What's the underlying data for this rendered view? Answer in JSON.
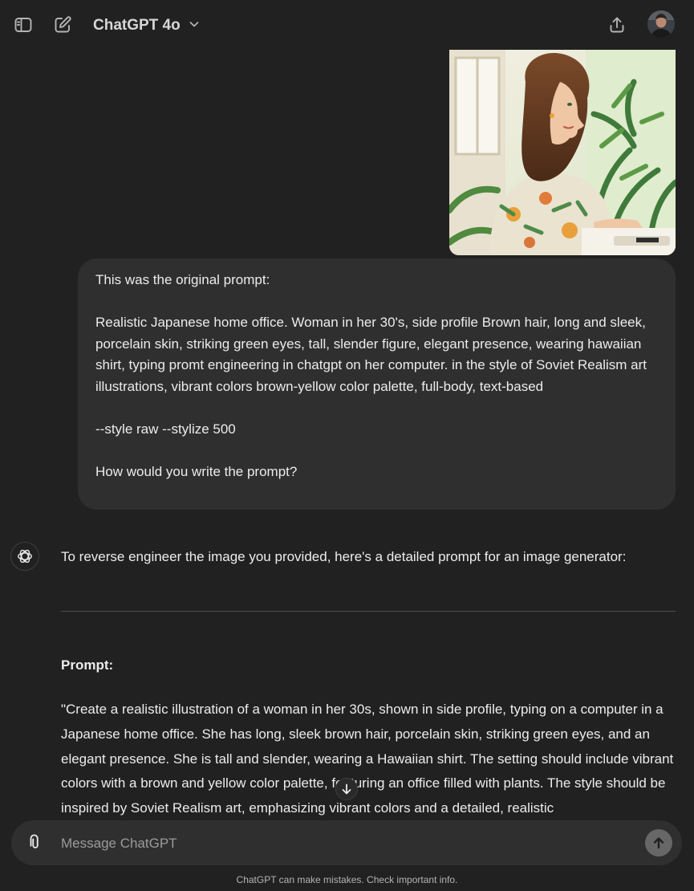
{
  "header": {
    "model_name": "ChatGPT 4o",
    "icons": [
      "sidebar-toggle-icon",
      "new-chat-icon",
      "chevron-down-icon",
      "share-icon",
      "avatar"
    ]
  },
  "conversation": {
    "user_message": {
      "line1": "This was the original prompt:",
      "line2": "Realistic Japanese home office. Woman in her 30's, side profile Brown hair, long and sleek, porcelain skin, striking green eyes, tall, slender figure, elegant presence, wearing hawaiian shirt, typing promt engineering in chatgpt on her computer. in the style of Soviet Realism art illustrations, vibrant colors brown-yellow color palette, full-body, text-based",
      "line3": "--style  raw --stylize  500",
      "line4": "How would you write the prompt?"
    },
    "assistant_message": {
      "intro": "To reverse engineer the image you provided, here's a detailed prompt for an image generator:",
      "heading": "Prompt:",
      "body": "\"Create a realistic illustration of a woman in her 30s, shown in side profile, typing on a computer in a Japanese home office. She has long, sleek brown hair, porcelain skin, striking green eyes, and an elegant presence. She is tall and slender, wearing a Hawaiian shirt. The setting should include vibrant colors with a brown and yellow color palette, featuring an office filled with plants. The style should be inspired by Soviet Realism art, emphasizing vibrant colors and a detailed, realistic"
    }
  },
  "composer": {
    "placeholder": "Message ChatGPT"
  },
  "footer": {
    "disclaimer": "ChatGPT can make mistakes. Check important info."
  },
  "colors": {
    "background": "#212121",
    "bubble": "#2f2f2f",
    "text": "#ececec",
    "muted": "#9b9b9b",
    "send_button": "#676767"
  }
}
